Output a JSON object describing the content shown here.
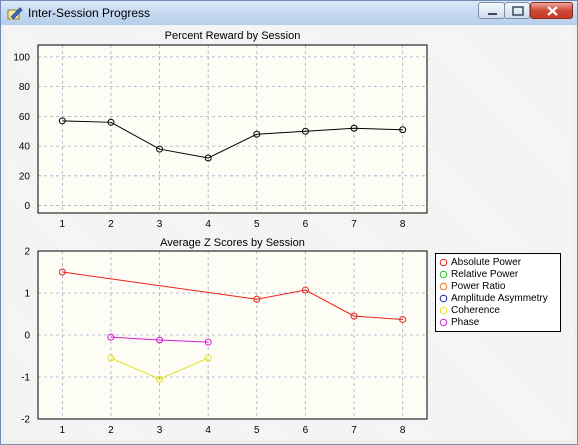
{
  "window": {
    "title": "Inter-Session Progress"
  },
  "colors": {
    "titlebar": "#c3d7f0",
    "plot_bg": "#fdfdf5",
    "grid": "#a9a9c8"
  },
  "icons": {
    "app": "pencil-document-icon",
    "minimize": "minimize-icon",
    "maximize": "maximize-icon",
    "close": "close-icon"
  },
  "chart_data": [
    {
      "type": "line",
      "title": "Percent Reward by Session",
      "x": [
        1,
        2,
        3,
        4,
        5,
        6,
        7,
        8
      ],
      "x_ticks": [
        1,
        2,
        3,
        4,
        5,
        6,
        7,
        8
      ],
      "xlim": [
        0.5,
        8.5
      ],
      "ylim": [
        -5,
        108
      ],
      "y_ticks": [
        0,
        20,
        40,
        60,
        80,
        100
      ],
      "grid": true,
      "series": [
        {
          "color": "#000000",
          "values": [
            57,
            56,
            38,
            32,
            48,
            50,
            52,
            51
          ]
        }
      ]
    },
    {
      "type": "line",
      "title": "Average Z Scores by Session",
      "x": [
        1,
        2,
        3,
        4,
        5,
        6,
        7,
        8
      ],
      "x_ticks": [
        1,
        2,
        3,
        4,
        5,
        6,
        7,
        8
      ],
      "xlim": [
        0.5,
        8.5
      ],
      "ylim": [
        -2,
        2
      ],
      "y_ticks": [
        -2,
        -1,
        0,
        1,
        2
      ],
      "grid": true,
      "legend_position": "right",
      "series": [
        {
          "name": "Absolute Power",
          "color": "#e8221a",
          "x": [
            1,
            5,
            6,
            7,
            8
          ],
          "values": [
            1.5,
            0.85,
            1.07,
            0.45,
            0.37
          ]
        },
        {
          "name": "Relative Power",
          "color": "#1ec81e",
          "x": [],
          "values": []
        },
        {
          "name": "Power Ratio",
          "color": "#e8721a",
          "x": [],
          "values": []
        },
        {
          "name": "Amplitude Asymmetry",
          "color": "#2424b4",
          "x": [],
          "values": []
        },
        {
          "name": "Coherence",
          "color": "#e6e01e",
          "x": [
            2,
            3,
            4
          ],
          "values": [
            -0.55,
            -1.05,
            -0.55
          ]
        },
        {
          "name": "Phase",
          "color": "#d21ed2",
          "x": [
            2,
            3,
            4
          ],
          "values": [
            -0.05,
            -0.12,
            -0.17
          ]
        }
      ]
    }
  ]
}
